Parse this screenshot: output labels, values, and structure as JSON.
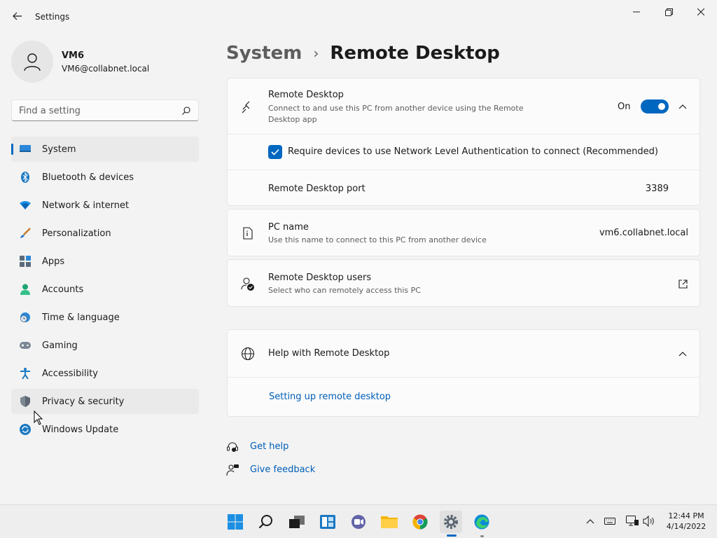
{
  "window": {
    "title": "Settings"
  },
  "user": {
    "name": "VM6",
    "email": "VM6@collabnet.local"
  },
  "search": {
    "placeholder": "Find a setting",
    "value": ""
  },
  "nav": {
    "items": [
      {
        "label": "System",
        "icon": "monitor-icon",
        "selected": true
      },
      {
        "label": "Bluetooth & devices",
        "icon": "bluetooth-icon"
      },
      {
        "label": "Network & internet",
        "icon": "wifi-icon"
      },
      {
        "label": "Personalization",
        "icon": "brush-icon"
      },
      {
        "label": "Apps",
        "icon": "apps-icon"
      },
      {
        "label": "Accounts",
        "icon": "person-icon"
      },
      {
        "label": "Time & language",
        "icon": "globe-clock-icon"
      },
      {
        "label": "Gaming",
        "icon": "gamepad-icon"
      },
      {
        "label": "Accessibility",
        "icon": "accessibility-icon"
      },
      {
        "label": "Privacy & security",
        "icon": "shield-icon"
      },
      {
        "label": "Windows Update",
        "icon": "update-icon"
      }
    ]
  },
  "breadcrumb": {
    "parent": "System",
    "separator": "›",
    "current": "Remote Desktop"
  },
  "remote_desktop": {
    "title": "Remote Desktop",
    "description": "Connect to and use this PC from another device using the Remote Desktop app",
    "toggle_label": "On",
    "toggle_on": true,
    "nla_label": "Require devices to use Network Level Authentication to connect (Recommended)",
    "nla_checked": true,
    "port_label": "Remote Desktop port",
    "port_value": "3389"
  },
  "pc_name": {
    "title": "PC name",
    "description": "Use this name to connect to this PC from another device",
    "value": "vm6.collabnet.local"
  },
  "users": {
    "title": "Remote Desktop users",
    "description": "Select who can remotely access this PC"
  },
  "help": {
    "title": "Help with Remote Desktop",
    "link": "Setting up remote desktop"
  },
  "footer": {
    "get_help": "Get help",
    "give_feedback": "Give feedback"
  },
  "taskbar": {
    "apps": [
      "start-icon",
      "search-icon",
      "task-view-icon",
      "widgets-icon",
      "chat-icon",
      "file-explorer-icon",
      "chrome-icon",
      "settings-icon",
      "edge-icon"
    ],
    "time": "12:44 PM",
    "date": "4/14/2022"
  },
  "colors": {
    "accent": "#0067c0",
    "link": "#005fb8"
  }
}
